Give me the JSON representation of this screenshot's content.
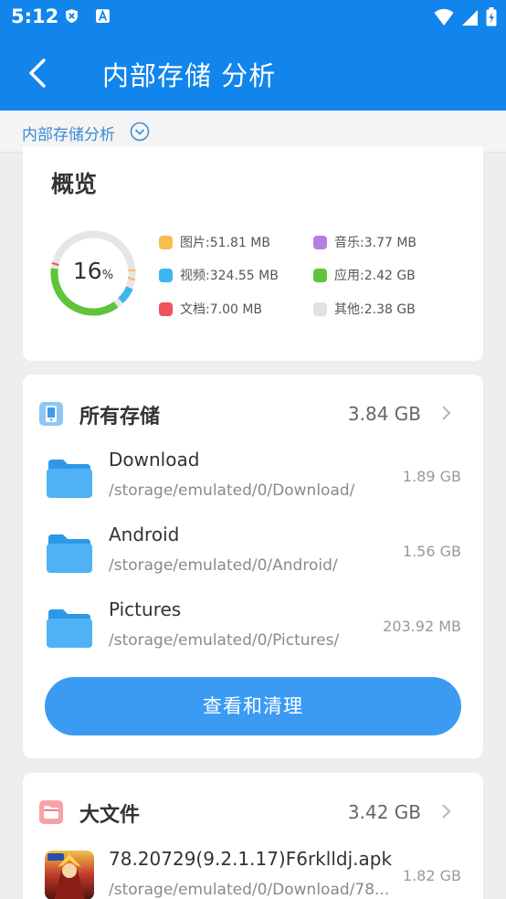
{
  "status_bar": {
    "time": "5:12",
    "left_icons": [
      "shield-icon",
      "text-a-icon"
    ],
    "right_icons": [
      "wifi-icon",
      "signal-icon",
      "battery-icon"
    ]
  },
  "toolbar": {
    "title": "内部存储 分析",
    "back_icon": "back-arrow-icon",
    "color": "#1185eb"
  },
  "sub_bar": {
    "label": "内部存储分析",
    "icon": "chevron-down-circle-icon"
  },
  "overview": {
    "title": "概览",
    "used_percent_value": "16",
    "percent_sign": "%",
    "legend": [
      {
        "label": "图片:51.81 MB",
        "color": "#f7be4d"
      },
      {
        "label": "音乐:3.77 MB",
        "color": "#b57ee0"
      },
      {
        "label": "视频:324.55 MB",
        "color": "#3cb5f0"
      },
      {
        "label": "应用:2.42 GB",
        "color": "#5ec43a"
      },
      {
        "label": "文档:7.00 MB",
        "color": "#f0525a"
      },
      {
        "label": "其他:2.38 GB",
        "color": "#e1e1e1"
      }
    ]
  },
  "all_storage": {
    "title": "所有存储",
    "total": "3.84 GB",
    "items": [
      {
        "name": "Download",
        "path": "/storage/emulated/0/Download/",
        "size": "1.89 GB"
      },
      {
        "name": "Android",
        "path": "/storage/emulated/0/Android/",
        "size": "1.56 GB"
      },
      {
        "name": "Pictures",
        "path": "/storage/emulated/0/Pictures/",
        "size": "203.92 MB"
      }
    ],
    "button_label": "查看和清理"
  },
  "big_files": {
    "title": "大文件",
    "total": "3.42 GB",
    "items": [
      {
        "name": "78.20729(9.2.1.17)F6rklldj.apk",
        "path": "/storage/emulated/0/Download/78...",
        "size": "1.82 GB"
      }
    ]
  }
}
